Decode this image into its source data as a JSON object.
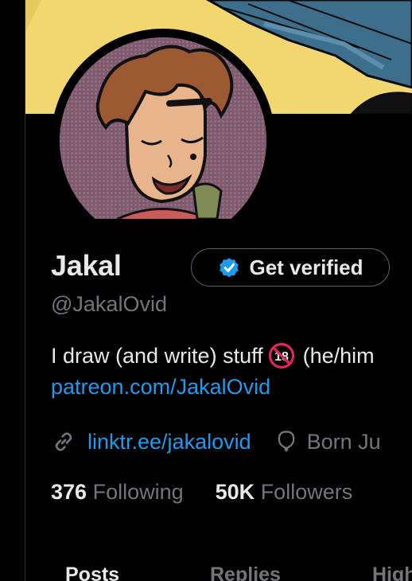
{
  "profile": {
    "name": "Jakal",
    "handle": "@JakalOvid",
    "verify_label": "Get verified",
    "bio_text": "I draw (and write) stuff",
    "bio_badge": "18",
    "bio_pronouns": "(he/him",
    "bio_link": "patreon.com/JakalOvid",
    "website": "linktr.ee/jakalovid",
    "born": "Born Ju"
  },
  "stats": {
    "following_count": "376",
    "following_label": "Following",
    "followers_count": "50K",
    "followers_label": "Followers"
  },
  "tabs": [
    {
      "label": "Posts"
    },
    {
      "label": "Replies"
    },
    {
      "label": "High"
    }
  ],
  "colors": {
    "background": "#000000",
    "accent": "#1d9bf0",
    "muted": "#71767b",
    "banner": "#f2d770"
  }
}
